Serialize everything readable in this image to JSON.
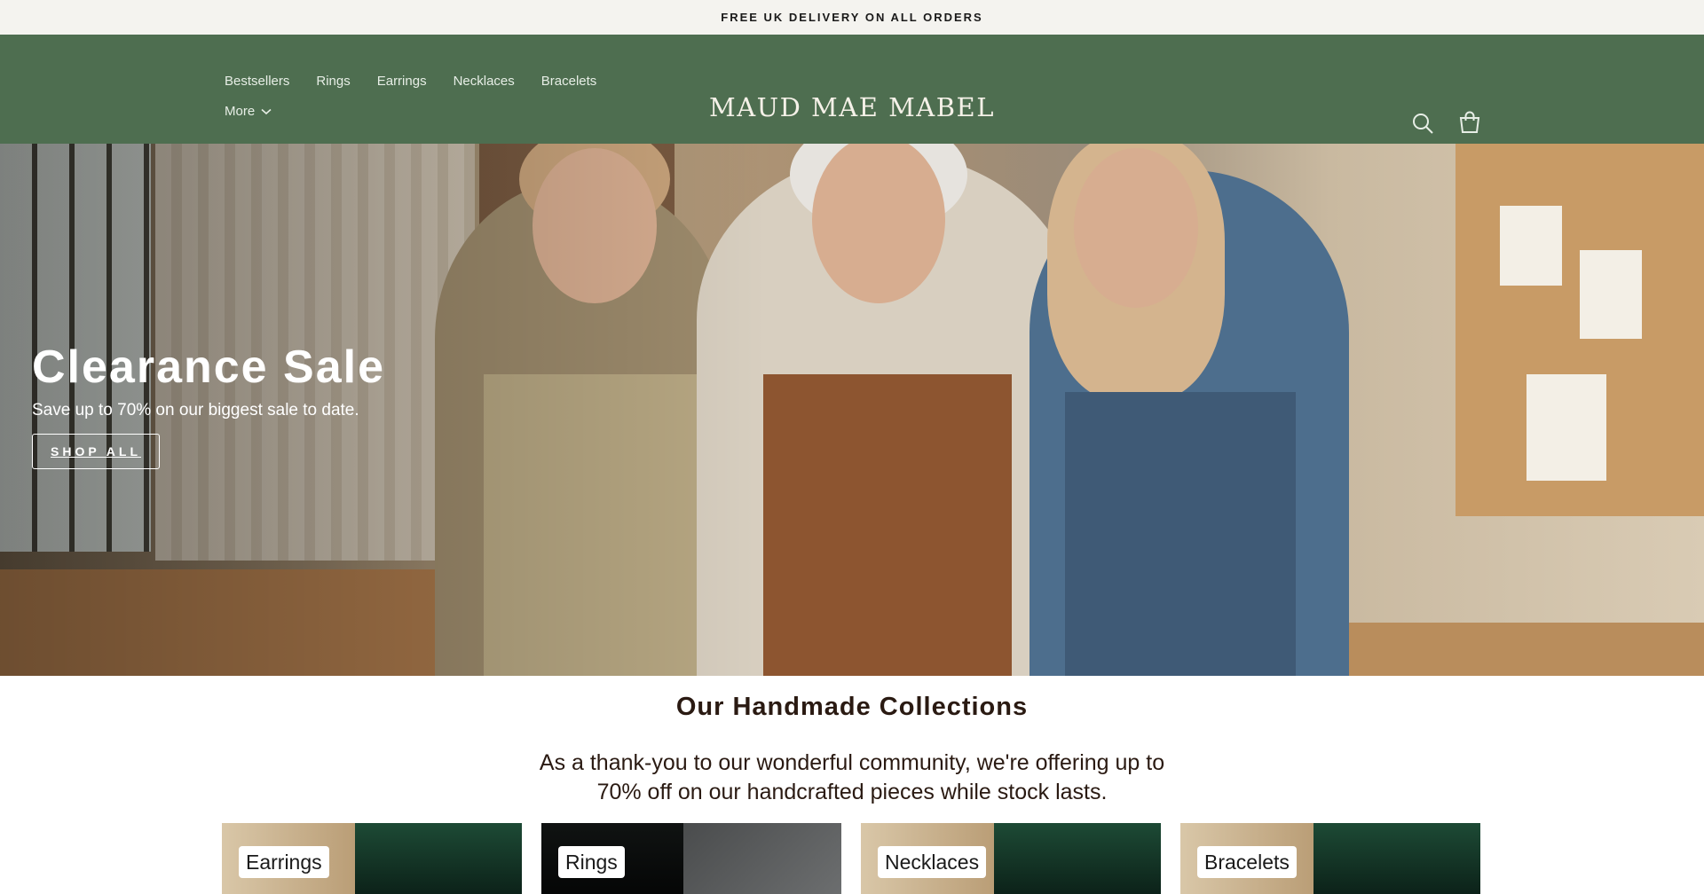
{
  "announcement": "FREE UK DELIVERY ON ALL ORDERS",
  "header": {
    "nav": [
      "Bestsellers",
      "Rings",
      "Earrings",
      "Necklaces",
      "Bracelets"
    ],
    "more_label": "More",
    "logo": "MAUD MAE MABEL",
    "icons": [
      "search-icon",
      "cart-icon"
    ],
    "background_color": "#4e6e50"
  },
  "hero": {
    "title": "Clearance Sale",
    "subtitle": "Save up to 70% on our biggest sale to date.",
    "button": "SHOP ALL"
  },
  "collections": {
    "title": "Our Handmade Collections",
    "text": "As a thank-you to our wonderful community, we're offering up to 70% off on our handcrafted pieces while stock lasts.",
    "cards": [
      "Earrings",
      "Rings",
      "Necklaces",
      "Bracelets"
    ]
  }
}
